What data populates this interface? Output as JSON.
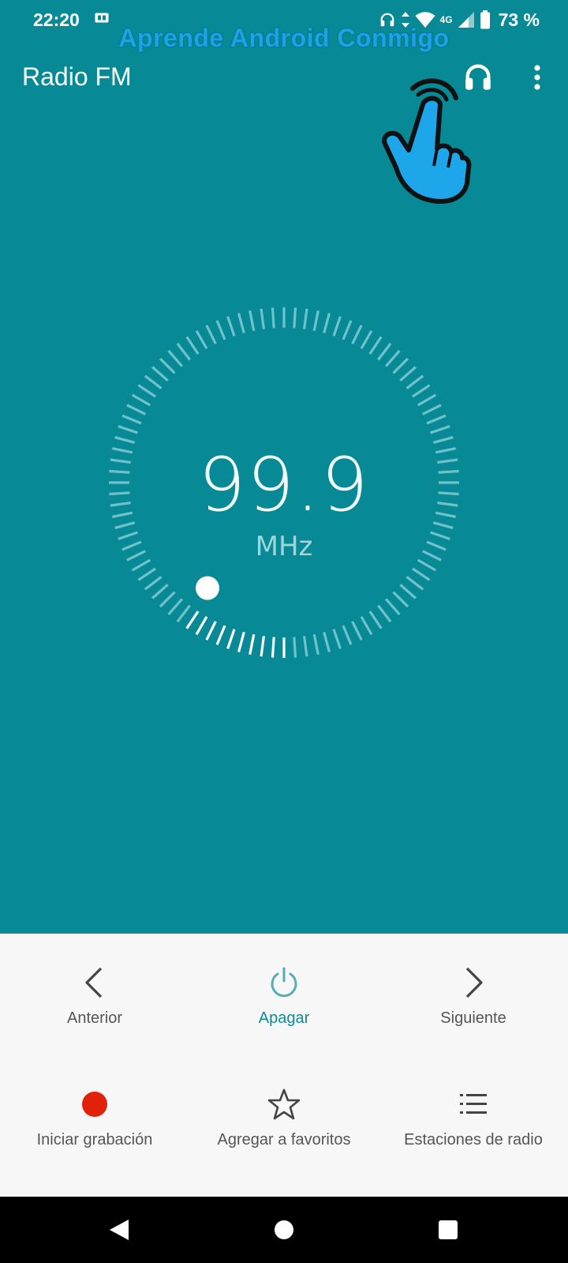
{
  "status_bar": {
    "time": "22:20",
    "network": "4G",
    "battery": "73 %"
  },
  "watermark": "Aprende Android Conmigo",
  "toolbar": {
    "title": "Radio FM",
    "headset_icon": "headset-icon",
    "overflow_icon": "more-vert-icon"
  },
  "tuner": {
    "frequency": "99.9",
    "unit": "MHz",
    "dial_position": 0.1,
    "colors": {
      "background": "#088a96",
      "tick": "#6fc2ca",
      "active_tick": "#ffffff"
    }
  },
  "controls": {
    "previous": {
      "label": "Anterior",
      "icon": "chevron-left-icon"
    },
    "power": {
      "label": "Apagar",
      "icon": "power-icon",
      "color": "#0c8b99"
    },
    "next": {
      "label": "Siguiente",
      "icon": "chevron-right-icon"
    },
    "record": {
      "label": "Iniciar grabación",
      "icon": "record-dot-icon",
      "color": "#e2210b"
    },
    "favorite": {
      "label": "Agregar a favoritos",
      "icon": "star-outline-icon"
    },
    "stations": {
      "label": "Estaciones de radio",
      "icon": "list-icon"
    }
  },
  "navbar": {
    "back": "back-icon",
    "home": "home-icon",
    "recents": "recents-icon"
  }
}
